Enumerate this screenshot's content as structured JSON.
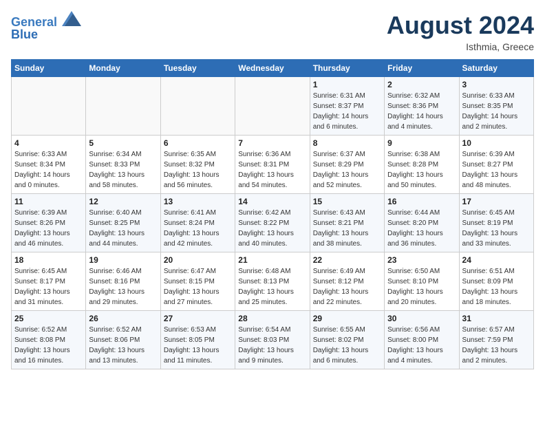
{
  "header": {
    "logo_line1": "General",
    "logo_line2": "Blue",
    "month_title": "August 2024",
    "location": "Isthmia, Greece"
  },
  "weekdays": [
    "Sunday",
    "Monday",
    "Tuesday",
    "Wednesday",
    "Thursday",
    "Friday",
    "Saturday"
  ],
  "weeks": [
    [
      {
        "day": "",
        "info": ""
      },
      {
        "day": "",
        "info": ""
      },
      {
        "day": "",
        "info": ""
      },
      {
        "day": "",
        "info": ""
      },
      {
        "day": "1",
        "info": "Sunrise: 6:31 AM\nSunset: 8:37 PM\nDaylight: 14 hours\nand 6 minutes."
      },
      {
        "day": "2",
        "info": "Sunrise: 6:32 AM\nSunset: 8:36 PM\nDaylight: 14 hours\nand 4 minutes."
      },
      {
        "day": "3",
        "info": "Sunrise: 6:33 AM\nSunset: 8:35 PM\nDaylight: 14 hours\nand 2 minutes."
      }
    ],
    [
      {
        "day": "4",
        "info": "Sunrise: 6:33 AM\nSunset: 8:34 PM\nDaylight: 14 hours\nand 0 minutes."
      },
      {
        "day": "5",
        "info": "Sunrise: 6:34 AM\nSunset: 8:33 PM\nDaylight: 13 hours\nand 58 minutes."
      },
      {
        "day": "6",
        "info": "Sunrise: 6:35 AM\nSunset: 8:32 PM\nDaylight: 13 hours\nand 56 minutes."
      },
      {
        "day": "7",
        "info": "Sunrise: 6:36 AM\nSunset: 8:31 PM\nDaylight: 13 hours\nand 54 minutes."
      },
      {
        "day": "8",
        "info": "Sunrise: 6:37 AM\nSunset: 8:29 PM\nDaylight: 13 hours\nand 52 minutes."
      },
      {
        "day": "9",
        "info": "Sunrise: 6:38 AM\nSunset: 8:28 PM\nDaylight: 13 hours\nand 50 minutes."
      },
      {
        "day": "10",
        "info": "Sunrise: 6:39 AM\nSunset: 8:27 PM\nDaylight: 13 hours\nand 48 minutes."
      }
    ],
    [
      {
        "day": "11",
        "info": "Sunrise: 6:39 AM\nSunset: 8:26 PM\nDaylight: 13 hours\nand 46 minutes."
      },
      {
        "day": "12",
        "info": "Sunrise: 6:40 AM\nSunset: 8:25 PM\nDaylight: 13 hours\nand 44 minutes."
      },
      {
        "day": "13",
        "info": "Sunrise: 6:41 AM\nSunset: 8:24 PM\nDaylight: 13 hours\nand 42 minutes."
      },
      {
        "day": "14",
        "info": "Sunrise: 6:42 AM\nSunset: 8:22 PM\nDaylight: 13 hours\nand 40 minutes."
      },
      {
        "day": "15",
        "info": "Sunrise: 6:43 AM\nSunset: 8:21 PM\nDaylight: 13 hours\nand 38 minutes."
      },
      {
        "day": "16",
        "info": "Sunrise: 6:44 AM\nSunset: 8:20 PM\nDaylight: 13 hours\nand 36 minutes."
      },
      {
        "day": "17",
        "info": "Sunrise: 6:45 AM\nSunset: 8:19 PM\nDaylight: 13 hours\nand 33 minutes."
      }
    ],
    [
      {
        "day": "18",
        "info": "Sunrise: 6:45 AM\nSunset: 8:17 PM\nDaylight: 13 hours\nand 31 minutes."
      },
      {
        "day": "19",
        "info": "Sunrise: 6:46 AM\nSunset: 8:16 PM\nDaylight: 13 hours\nand 29 minutes."
      },
      {
        "day": "20",
        "info": "Sunrise: 6:47 AM\nSunset: 8:15 PM\nDaylight: 13 hours\nand 27 minutes."
      },
      {
        "day": "21",
        "info": "Sunrise: 6:48 AM\nSunset: 8:13 PM\nDaylight: 13 hours\nand 25 minutes."
      },
      {
        "day": "22",
        "info": "Sunrise: 6:49 AM\nSunset: 8:12 PM\nDaylight: 13 hours\nand 22 minutes."
      },
      {
        "day": "23",
        "info": "Sunrise: 6:50 AM\nSunset: 8:10 PM\nDaylight: 13 hours\nand 20 minutes."
      },
      {
        "day": "24",
        "info": "Sunrise: 6:51 AM\nSunset: 8:09 PM\nDaylight: 13 hours\nand 18 minutes."
      }
    ],
    [
      {
        "day": "25",
        "info": "Sunrise: 6:52 AM\nSunset: 8:08 PM\nDaylight: 13 hours\nand 16 minutes."
      },
      {
        "day": "26",
        "info": "Sunrise: 6:52 AM\nSunset: 8:06 PM\nDaylight: 13 hours\nand 13 minutes."
      },
      {
        "day": "27",
        "info": "Sunrise: 6:53 AM\nSunset: 8:05 PM\nDaylight: 13 hours\nand 11 minutes."
      },
      {
        "day": "28",
        "info": "Sunrise: 6:54 AM\nSunset: 8:03 PM\nDaylight: 13 hours\nand 9 minutes."
      },
      {
        "day": "29",
        "info": "Sunrise: 6:55 AM\nSunset: 8:02 PM\nDaylight: 13 hours\nand 6 minutes."
      },
      {
        "day": "30",
        "info": "Sunrise: 6:56 AM\nSunset: 8:00 PM\nDaylight: 13 hours\nand 4 minutes."
      },
      {
        "day": "31",
        "info": "Sunrise: 6:57 AM\nSunset: 7:59 PM\nDaylight: 13 hours\nand 2 minutes."
      }
    ]
  ]
}
